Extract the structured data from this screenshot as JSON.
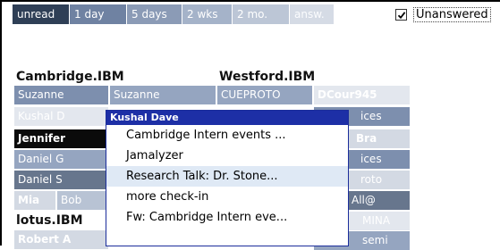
{
  "tabs": [
    "unread",
    "1 day",
    "5 days",
    "2 wks",
    "2 mo.",
    "answ."
  ],
  "unanswered": {
    "label": "Unanswered",
    "checked": true
  },
  "sites": {
    "cambridge": {
      "title": "Cambridge.IBM",
      "cells": [
        "Suzanne",
        "Suzanne",
        "Kushal D",
        "Jennifer",
        "Daniel G",
        "Daniel S",
        "Mia",
        "Bob"
      ]
    },
    "westford": {
      "title": "Westford.IBM",
      "cells": [
        "CUEPROTO",
        "DCour945",
        "ices",
        "Bra",
        "ices",
        "roto",
        "All@",
        "MINA",
        "semi"
      ]
    },
    "lotus": {
      "title": "lotus.IBM",
      "cells": [
        "Robert A"
      ]
    }
  },
  "menu": {
    "title": "Kushal Dave",
    "items": [
      "Cambridge Intern events ...",
      "Jamalyzer",
      "Research Talk: Dr. Stone...",
      "more check-in",
      "Fw: Cambridge Intern eve..."
    ]
  }
}
